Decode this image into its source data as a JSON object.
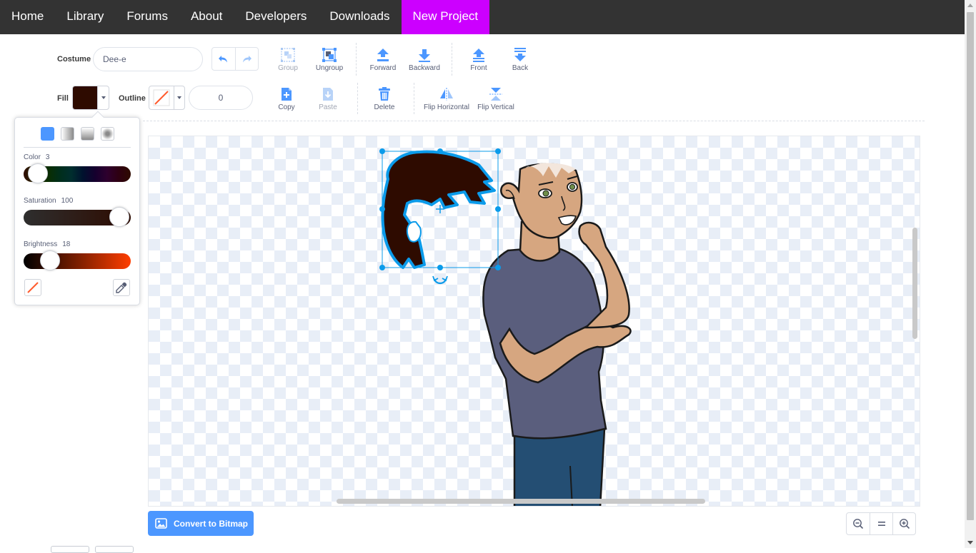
{
  "nav": {
    "items": [
      "Home",
      "Library",
      "Forums",
      "About",
      "Developers",
      "Downloads",
      "New Project"
    ],
    "active_index": 6,
    "active_color": "#cc00ff"
  },
  "toolbar": {
    "costume_label": "Costume",
    "costume_name": "Dee-e",
    "fill_label": "Fill",
    "fill_color": "#2e0b00",
    "outline_label": "Outline",
    "outline_width": "0",
    "undo_icon": "undo-icon",
    "redo_icon": "redo-icon",
    "tools": {
      "group": "Group",
      "ungroup": "Ungroup",
      "forward": "Forward",
      "backward": "Backward",
      "front": "Front",
      "back": "Back",
      "copy": "Copy",
      "paste": "Paste",
      "delete": "Delete",
      "flip_horizontal": "Flip Horizontal",
      "flip_vertical": "Flip Vertical"
    },
    "disabled_tools": [
      "Group",
      "Paste"
    ]
  },
  "color_picker": {
    "fill_modes": [
      "solid",
      "horizontal-gradient",
      "vertical-gradient",
      "radial-gradient"
    ],
    "selected_mode": "solid",
    "color_label": "Color",
    "color_value": "3",
    "saturation_label": "Saturation",
    "saturation_value": "100",
    "brightness_label": "Brightness",
    "brightness_value": "18",
    "levels": {
      "color": 3,
      "saturation": 100,
      "brightness": 18
    }
  },
  "canvas": {
    "convert_label": "Convert to Bitmap",
    "accent_color": "#4c97ff",
    "selection_color": "#0b9bea"
  }
}
